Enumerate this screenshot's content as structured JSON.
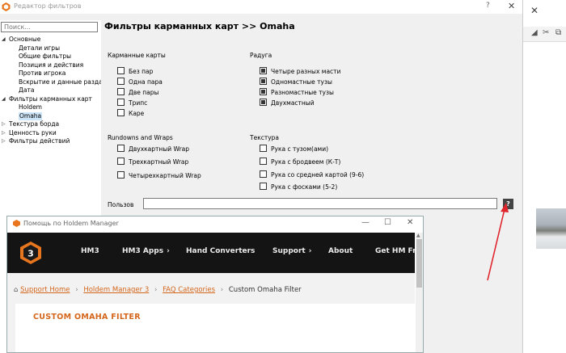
{
  "filter_editor": {
    "title": "Редактор фильтров",
    "help_glyph": "?",
    "close_glyph": "✕",
    "search_placeholder": "Поиск...",
    "tree": [
      {
        "label": "Основные",
        "level": 0,
        "arrow": "◢",
        "selected": false
      },
      {
        "label": "Детали игры",
        "level": 1,
        "arrow": "",
        "selected": false
      },
      {
        "label": "Общие фильтры",
        "level": 1,
        "arrow": "",
        "selected": false
      },
      {
        "label": "Позиция и действия",
        "level": 1,
        "arrow": "",
        "selected": false
      },
      {
        "label": "Против игрока",
        "level": 1,
        "arrow": "",
        "selected": false
      },
      {
        "label": "Вскрытие и данные раздач",
        "level": 1,
        "arrow": "",
        "selected": false
      },
      {
        "label": "Дата",
        "level": 1,
        "arrow": "",
        "selected": false
      },
      {
        "label": "Фильтры карманных карт",
        "level": 0,
        "arrow": "◢",
        "selected": false
      },
      {
        "label": "Holdem",
        "level": 1,
        "arrow": "",
        "selected": false
      },
      {
        "label": "Omaha",
        "level": 1,
        "arrow": "",
        "selected": true
      },
      {
        "label": "Текстура борда",
        "level": 0,
        "arrow": "▷",
        "selected": false
      },
      {
        "label": "Ценность руки",
        "level": 0,
        "arrow": "▷",
        "selected": false
      },
      {
        "label": "Фильтры действий",
        "level": 0,
        "arrow": "▷",
        "selected": false
      }
    ],
    "panel": {
      "title": "Фильтры карманных карт >> Omaha",
      "pocket_cards": {
        "title": "Карманные карты",
        "items": [
          {
            "label": "Без пар",
            "checked": false
          },
          {
            "label": "Одна пара",
            "checked": false
          },
          {
            "label": "Две пары",
            "checked": false
          },
          {
            "label": "Трипс",
            "checked": false
          },
          {
            "label": "Каре",
            "checked": false
          }
        ]
      },
      "rainbow": {
        "title": "Радуга",
        "items": [
          {
            "label": "Четыре разных масти",
            "checked": true
          },
          {
            "label": "Одномастные тузы",
            "checked": true
          },
          {
            "label": "Разномастные тузы",
            "checked": true
          },
          {
            "label": "Двухмастный",
            "checked": true
          }
        ]
      },
      "rundowns": {
        "title": "Rundowns and Wraps",
        "items": [
          {
            "label": "Двухкартный Wrap",
            "checked": false
          },
          {
            "label": "Трехкартный Wrap",
            "checked": false
          },
          {
            "label": "Четырехкартный Wrap",
            "checked": false
          }
        ]
      },
      "texture": {
        "title": "Текстура",
        "items": [
          {
            "label": "Рука с тузом(ами)",
            "checked": false
          },
          {
            "label": "Рука с бродвеем (К-Т)",
            "checked": false
          },
          {
            "label": "Рука со средней картой (9-6)",
            "checked": false
          },
          {
            "label": "Рука с фосками (5-2)",
            "checked": false
          }
        ]
      },
      "user_label": "Пользов",
      "user_value": "",
      "help_button": "?"
    }
  },
  "help_window": {
    "title": "Помощь по Holdem Manager",
    "controls": {
      "minimize": "—",
      "maximize": "☐",
      "close": "✕"
    },
    "logo_text": "3",
    "nav": [
      {
        "label": "HM3",
        "chevron": false
      },
      {
        "label": "HM3 Apps",
        "chevron": true
      },
      {
        "label": "Hand Converters",
        "chevron": false
      },
      {
        "label": "Support",
        "chevron": true
      },
      {
        "label": "About",
        "chevron": false
      },
      {
        "label": "Get HM Fre",
        "chevron": false
      }
    ],
    "chevron_glyph": "›",
    "breadcrumbs": {
      "home_glyph": "⌂",
      "items": [
        "Support Home",
        "Holdem Manager 3",
        "FAQ Categories"
      ],
      "current": "Custom Omaha Filter",
      "separator": "›"
    },
    "article_title": "CUSTOM OMAHA FILTER"
  },
  "background_window": {
    "close_glyph": "✕",
    "toolbar": [
      "◢",
      "✂",
      "⧉"
    ]
  },
  "colors": {
    "accent_orange": "#d4661c",
    "nav_bg": "#141414",
    "arrow_red": "#e0242b",
    "selected_bg": "#cce4f7"
  }
}
